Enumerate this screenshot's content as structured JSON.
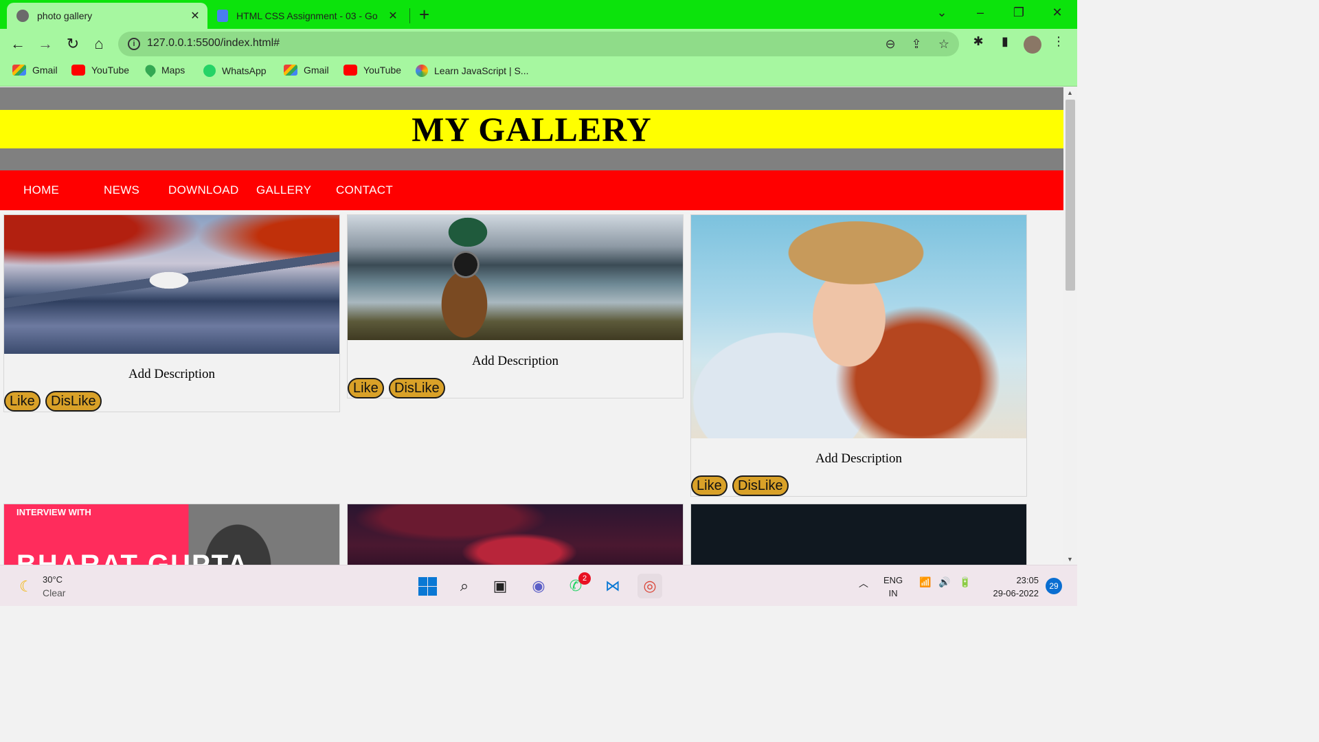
{
  "browser": {
    "tabs": [
      {
        "title": "photo gallery",
        "active": true
      },
      {
        "title": "HTML CSS Assignment - 03 - Go",
        "active": false
      }
    ],
    "url": "127.0.0.1:5500/index.html#",
    "bookmarks": [
      {
        "label": "Gmail",
        "icon": "gmail-icon"
      },
      {
        "label": "YouTube",
        "icon": "youtube-icon"
      },
      {
        "label": "Maps",
        "icon": "maps-icon"
      },
      {
        "label": "WhatsApp",
        "icon": "whatsapp-icon"
      },
      {
        "label": "Gmail",
        "icon": "gmail-icon"
      },
      {
        "label": "YouTube",
        "icon": "youtube-icon"
      },
      {
        "label": "Learn JavaScript | S...",
        "icon": "js-icon"
      }
    ],
    "colors": {
      "tabbar": "#0ce30c",
      "toolbar": "#a6f7a0"
    }
  },
  "page": {
    "title": "MY GALLERY",
    "nav": [
      "HOME",
      "NEWS",
      "DOWNLOAD",
      "GALLERY",
      "CONTACT"
    ],
    "cards": [
      {
        "description": "Add Description",
        "like": "Like",
        "dislike": "DisLike",
        "image": "autumn mountain lake"
      },
      {
        "description": "Add Description",
        "like": "Like",
        "dislike": "DisLike",
        "image": "photographer with camera at lake"
      },
      {
        "description": "Add Description",
        "like": "Like",
        "dislike": "DisLike",
        "image": "woman in sun hat at beach"
      }
    ],
    "partial_cards": [
      {
        "overlay_top": "INTERVIEW WITH",
        "overlay_name": "BHARAT GUPTA"
      },
      {},
      {}
    ],
    "colors": {
      "header": "#ffff00",
      "nav": "#ff0000",
      "band": "#808080",
      "button": "#d9a128"
    }
  },
  "taskbar": {
    "weather": {
      "temp": "30°C",
      "condition": "Clear"
    },
    "whatsapp_badge": "2",
    "lang": {
      "line1": "ENG",
      "line2": "IN"
    },
    "time": "23:05",
    "date": "29-06-2022",
    "notifications": "29"
  }
}
